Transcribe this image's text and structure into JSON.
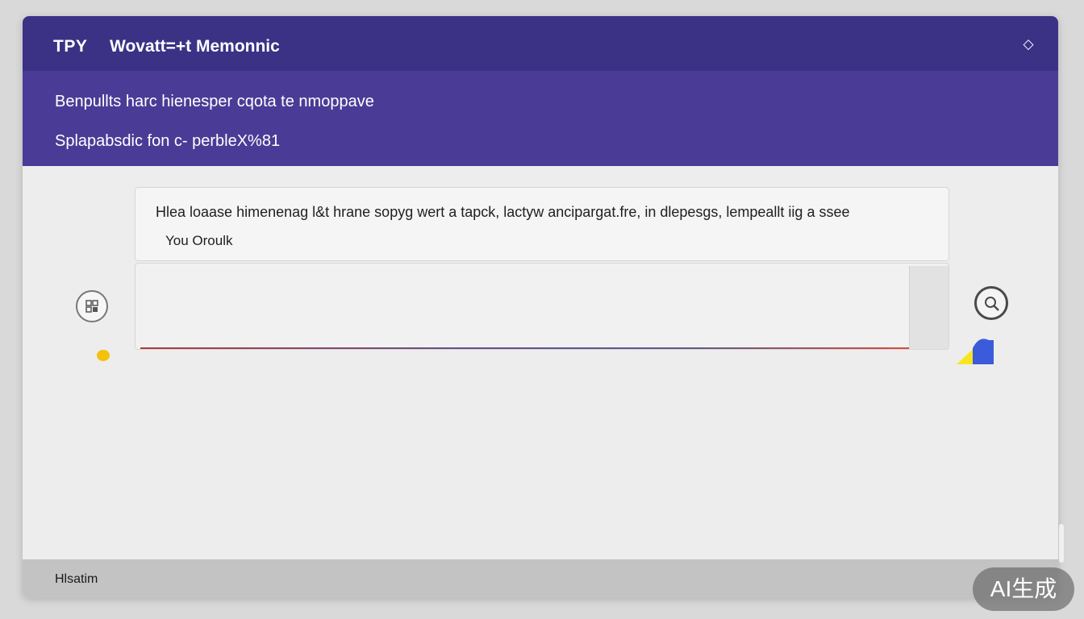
{
  "header": {
    "brand": "TPY",
    "title": "Wovatt=+t Memonnic",
    "settings_icon": "diamond-icon"
  },
  "subheader": {
    "line1": "Benpullts harc hienesper cqota te nmoppave",
    "line2": "Splapabsdic fon c- perbleX%81"
  },
  "conversation": {
    "message_text": "Hlea loaase himenenag l&t hrane sopyg wert a tapck, lactyw ancipargat.fre, in dlepesgs, lempeallt iig a ssee",
    "sender": "You Oroulk"
  },
  "composer": {
    "placeholder": "",
    "value": ""
  },
  "statusbar": {
    "text": "Hlsatim"
  },
  "badge": {
    "text": "AI生成"
  },
  "colors": {
    "header_bg": "#3b3286",
    "subheader_bg": "#4a3c96",
    "status_dot": "#f4c20d",
    "send_blue": "#3b5bdb",
    "send_yellow": "#f7e51e"
  }
}
